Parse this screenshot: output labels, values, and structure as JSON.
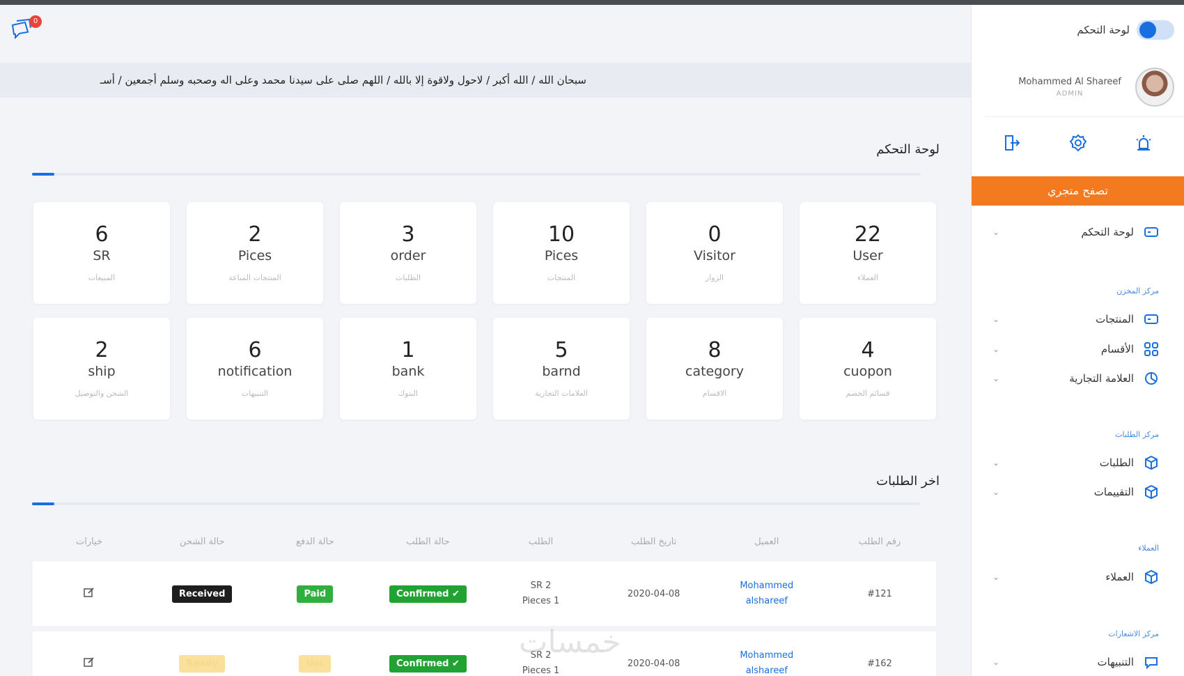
{
  "chat": {
    "badge": "0"
  },
  "sidebar": {
    "toggle_label": "لوحة التحكم",
    "user": {
      "name": "Mohammed Al Shareef",
      "role": "ADMIN"
    },
    "store_button": "تصفح متجري",
    "items": [
      {
        "label": "لوحة التحكم"
      },
      {
        "label": "المنتجات"
      },
      {
        "label": "الأقسام"
      },
      {
        "label": "العلامة التجارية"
      },
      {
        "label": "الطلبات"
      },
      {
        "label": "التقييمات"
      },
      {
        "label": "العملاء"
      },
      {
        "label": "التنبيهات"
      }
    ],
    "sections": [
      "مركز المخزن",
      "مركز الطلبات",
      "العملاء",
      "مركز الاشعارات"
    ]
  },
  "marquee": "سبحان الله / الله أكبر / لاحول ولاقوة إلا بالله / اللهم صلى على سيدنا محمد وعلى اله وصحبه وسلم أجمعين / أسـ",
  "dashboard": {
    "title": "لوحة التحكم",
    "stats": [
      {
        "value": "22",
        "unit": "User",
        "sub": "العملاء"
      },
      {
        "value": "0",
        "unit": "Visitor",
        "sub": "الزوار"
      },
      {
        "value": "10",
        "unit": "Pices",
        "sub": "المنتجات"
      },
      {
        "value": "3",
        "unit": "order",
        "sub": "الطلبات"
      },
      {
        "value": "2",
        "unit": "Pices",
        "sub": "المنتجات المباعة"
      },
      {
        "value": "6",
        "unit": "SR",
        "sub": "المبيعات"
      },
      {
        "value": "4",
        "unit": "cuopon",
        "sub": "قسائم الخصم"
      },
      {
        "value": "8",
        "unit": "category",
        "sub": "الاقسام"
      },
      {
        "value": "5",
        "unit": "barnd",
        "sub": "العلامات التجارية"
      },
      {
        "value": "1",
        "unit": "bank",
        "sub": "البنوك"
      },
      {
        "value": "6",
        "unit": "notification",
        "sub": "التنبيهات"
      },
      {
        "value": "2",
        "unit": "ship",
        "sub": "الشحن والتوصيل"
      }
    ]
  },
  "orders": {
    "title": "اخر الطلبات",
    "columns": [
      "رقم الطلب",
      "العميل",
      "تاريخ الطلب",
      "الطلب",
      "حالة الطلب",
      "حالة الدفع",
      "حالة الشحن",
      "خيارات"
    ],
    "rows": [
      {
        "id": "#121",
        "customer_line1": "Mohammed",
        "customer_line2": "alshareef",
        "date": "2020-04-08",
        "order_line1": "SR 2",
        "order_line2": "Pieces 1",
        "status": "Confirmed ✔",
        "payment": "Paid",
        "shipping": "Received"
      },
      {
        "id": "#162",
        "customer_line1": "Mohammed",
        "customer_line2": "alshareef",
        "date": "2020-04-08",
        "order_line1": "SR 2",
        "order_line2": "Pieces 1",
        "status": "Confirmed ✔",
        "payment": "Not",
        "shipping": "Ready"
      }
    ]
  },
  "watermark": "خمسات"
}
